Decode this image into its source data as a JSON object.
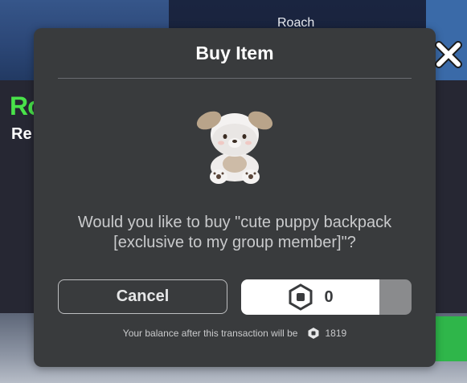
{
  "background": {
    "player_name": "Roach",
    "green_text": "Ro",
    "white_text": "Re"
  },
  "modal": {
    "title": "Buy Item",
    "question": "Would you like to buy \"cute puppy backpack [exclusive to my group member]\"?",
    "cancel_label": "Cancel",
    "price": "0",
    "balance_label": "Your balance after this transaction will be",
    "balance_value": "1819"
  },
  "icons": {
    "close": "close-icon",
    "currency": "robux-icon",
    "item": "puppy-backpack-thumbnail"
  },
  "colors": {
    "modal_bg": "#393b3d",
    "buy_button_bg": "#ffffff",
    "text_muted": "#c9cacc"
  }
}
